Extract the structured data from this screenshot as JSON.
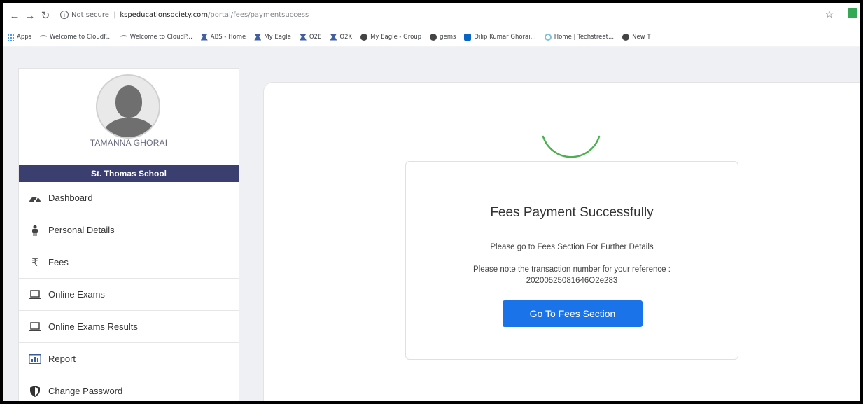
{
  "browser": {
    "security_label": "Not secure",
    "url_host": "kspeducationsociety.com",
    "url_path": "/portal/fees/paymentsuccess",
    "bookmarks": [
      {
        "label": "Apps",
        "icon": "apps-icon"
      },
      {
        "label": "Welcome to CloudF...",
        "icon": "cloud-icon"
      },
      {
        "label": "Welcome to CloudP...",
        "icon": "cloud-icon"
      },
      {
        "label": "ABS - Home",
        "icon": "eagle-icon"
      },
      {
        "label": "My Eagle",
        "icon": "eagle-icon"
      },
      {
        "label": "O2E",
        "icon": "eagle-icon"
      },
      {
        "label": "O2K",
        "icon": "eagle-icon"
      },
      {
        "label": "My Eagle - Group",
        "icon": "globe-icon"
      },
      {
        "label": "gems",
        "icon": "globe-icon"
      },
      {
        "label": "Dilip Kumar Ghorai...",
        "icon": "outlook-icon"
      },
      {
        "label": "Home | Techstreet...",
        "icon": "circle-icon"
      },
      {
        "label": "New T",
        "icon": "globe-icon"
      }
    ]
  },
  "sidebar": {
    "user_name": "TAMANNA GHORAI",
    "school": "St. Thomas School",
    "items": [
      {
        "label": "Dashboard",
        "icon": "dashboard-icon"
      },
      {
        "label": "Personal Details",
        "icon": "person-icon"
      },
      {
        "label": "Fees",
        "icon": "rupee-icon"
      },
      {
        "label": "Online Exams",
        "icon": "laptop-icon"
      },
      {
        "label": "Online Exams Results",
        "icon": "laptop-icon"
      },
      {
        "label": "Report",
        "icon": "bar-chart-icon"
      },
      {
        "label": "Change Password",
        "icon": "shield-icon"
      }
    ]
  },
  "payment": {
    "title": "Fees Payment Successfully",
    "message1": "Please go to Fees Section For Further Details",
    "message2": "Please note the transaction number for your reference :",
    "transaction_number": "20200525081646O2e283",
    "button_label": "Go To Fees Section"
  },
  "colors": {
    "school_bar": "#3b3f70",
    "button": "#1a73e8",
    "spinner": "#4caf50"
  }
}
